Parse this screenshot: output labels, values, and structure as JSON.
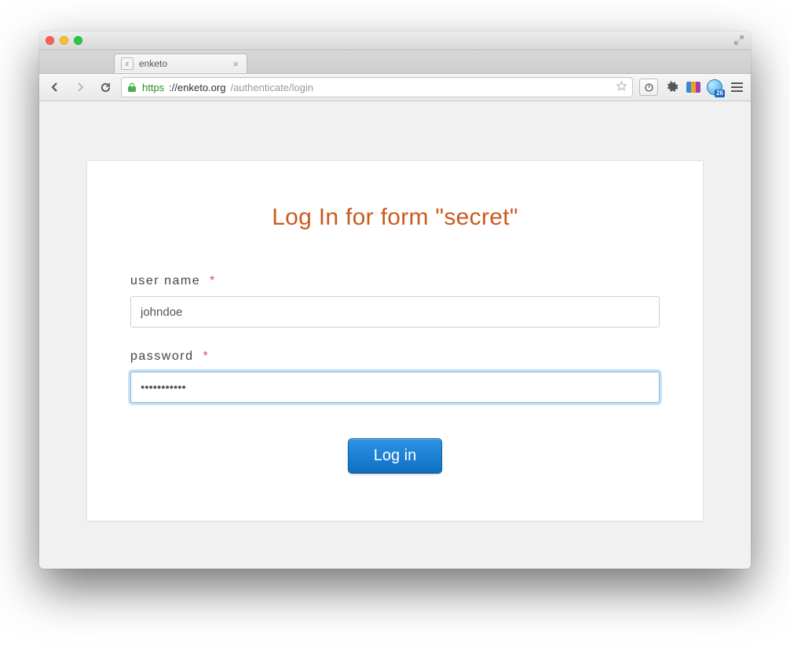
{
  "browser": {
    "tab_title": "enketo",
    "url_protocol": "https",
    "url_host": "://enketo.org",
    "url_path": "/authenticate/login",
    "badge_count": "26"
  },
  "page": {
    "heading": "Log In for form \"secret\"",
    "username_label": "user name",
    "username_value": "johndoe",
    "password_label": "password",
    "password_value": "•••••••••••",
    "required_mark": "*",
    "submit_label": "Log in"
  }
}
